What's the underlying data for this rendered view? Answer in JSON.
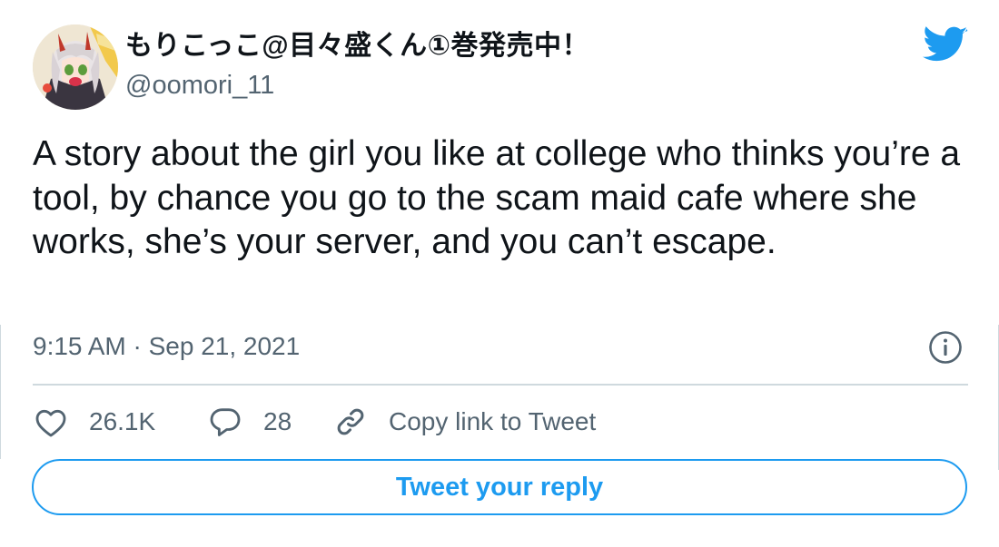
{
  "author": {
    "display_name": "もりこっこ@目々盛くん①巻発売中！",
    "handle": "@oomori_11"
  },
  "icons": {
    "avatar": "anime-girl-avatar",
    "brand": "twitter-bird-icon",
    "info": "info-icon",
    "like": "heart-icon",
    "reply": "reply-bubble-icon",
    "link": "link-icon"
  },
  "tweet": {
    "text": "A story about the girl you like at college who thinks you’re a tool, by chance you go to the scam maid cafe where she works, she’s your server, and you can’t escape.",
    "timestamp": "9:15 AM · Sep 21, 2021"
  },
  "actions": {
    "likes": "26.1K",
    "replies": "28",
    "copy_link_label": "Copy link to Tweet"
  },
  "reply_button_label": "Tweet your reply",
  "colors": {
    "brand_blue": "#1d9bf0",
    "text": "#0f1419",
    "secondary_text": "#536471"
  }
}
